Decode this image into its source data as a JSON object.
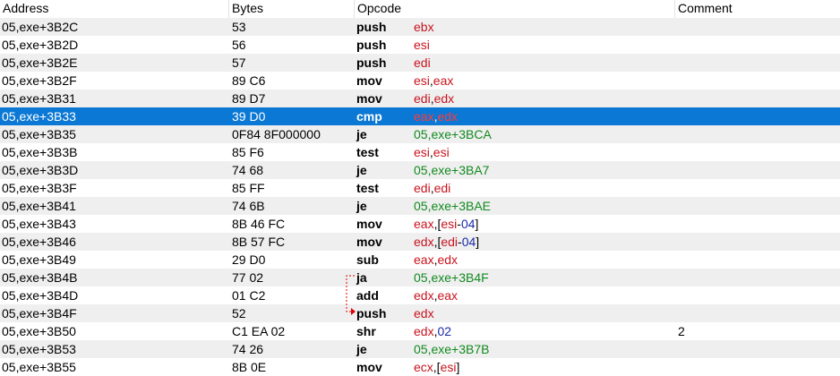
{
  "columns": {
    "address": "Address",
    "bytes": "Bytes",
    "opcode": "Opcode",
    "comment": "Comment"
  },
  "selected_row": 5,
  "colors": {
    "register": "#c8141e",
    "number": "#1a2aa8",
    "symbol": "#138a1e",
    "selection": "#0a78d4",
    "shaded_row": "#efeff0",
    "jump_arrow": "#e00000"
  },
  "rows": [
    {
      "address": "05,exe+3B2C",
      "bytes": "53",
      "opcode": "push",
      "args": [
        {
          "t": "ebx",
          "k": "reg"
        }
      ],
      "comment": ""
    },
    {
      "address": "05,exe+3B2D",
      "bytes": "56",
      "opcode": "push",
      "args": [
        {
          "t": "esi",
          "k": "reg"
        }
      ],
      "comment": ""
    },
    {
      "address": "05,exe+3B2E",
      "bytes": "57",
      "opcode": "push",
      "args": [
        {
          "t": "edi",
          "k": "reg"
        }
      ],
      "comment": ""
    },
    {
      "address": "05,exe+3B2F",
      "bytes": "89 C6",
      "opcode": "mov",
      "args": [
        {
          "t": "esi",
          "k": "reg"
        },
        {
          "t": ",",
          "k": "p"
        },
        {
          "t": "eax",
          "k": "reg"
        }
      ],
      "comment": ""
    },
    {
      "address": "05,exe+3B31",
      "bytes": "89 D7",
      "opcode": "mov",
      "args": [
        {
          "t": "edi",
          "k": "reg"
        },
        {
          "t": ",",
          "k": "p"
        },
        {
          "t": "edx",
          "k": "reg"
        }
      ],
      "comment": ""
    },
    {
      "address": "05,exe+3B33",
      "bytes": "39 D0",
      "opcode": "cmp",
      "args": [
        {
          "t": "eax",
          "k": "reg"
        },
        {
          "t": ",",
          "k": "p"
        },
        {
          "t": "edx",
          "k": "reg"
        }
      ],
      "comment": ""
    },
    {
      "address": "05,exe+3B35",
      "bytes": "0F84 8F000000",
      "opcode": "je",
      "args": [
        {
          "t": "05,exe+3BCA",
          "k": "sym"
        }
      ],
      "comment": ""
    },
    {
      "address": "05,exe+3B3B",
      "bytes": "85 F6",
      "opcode": "test",
      "args": [
        {
          "t": "esi",
          "k": "reg"
        },
        {
          "t": ",",
          "k": "p"
        },
        {
          "t": "esi",
          "k": "reg"
        }
      ],
      "comment": ""
    },
    {
      "address": "05,exe+3B3D",
      "bytes": "74 68",
      "opcode": "je",
      "args": [
        {
          "t": "05,exe+3BA7",
          "k": "sym"
        }
      ],
      "comment": ""
    },
    {
      "address": "05,exe+3B3F",
      "bytes": "85 FF",
      "opcode": "test",
      "args": [
        {
          "t": "edi",
          "k": "reg"
        },
        {
          "t": ",",
          "k": "p"
        },
        {
          "t": "edi",
          "k": "reg"
        }
      ],
      "comment": ""
    },
    {
      "address": "05,exe+3B41",
      "bytes": "74 6B",
      "opcode": "je",
      "args": [
        {
          "t": "05,exe+3BAE",
          "k": "sym"
        }
      ],
      "comment": ""
    },
    {
      "address": "05,exe+3B43",
      "bytes": "8B 46 FC",
      "opcode": "mov",
      "args": [
        {
          "t": "eax",
          "k": "reg"
        },
        {
          "t": ",[",
          "k": "p"
        },
        {
          "t": "esi",
          "k": "reg"
        },
        {
          "t": "-",
          "k": "p"
        },
        {
          "t": "04",
          "k": "num"
        },
        {
          "t": "]",
          "k": "p"
        }
      ],
      "comment": ""
    },
    {
      "address": "05,exe+3B46",
      "bytes": "8B 57 FC",
      "opcode": "mov",
      "args": [
        {
          "t": "edx",
          "k": "reg"
        },
        {
          "t": ",[",
          "k": "p"
        },
        {
          "t": "edi",
          "k": "reg"
        },
        {
          "t": "-",
          "k": "p"
        },
        {
          "t": "04",
          "k": "num"
        },
        {
          "t": "]",
          "k": "p"
        }
      ],
      "comment": ""
    },
    {
      "address": "05,exe+3B49",
      "bytes": "29 D0",
      "opcode": "sub",
      "args": [
        {
          "t": "eax",
          "k": "reg"
        },
        {
          "t": ",",
          "k": "p"
        },
        {
          "t": "edx",
          "k": "reg"
        }
      ],
      "comment": ""
    },
    {
      "address": "05,exe+3B4B",
      "bytes": "77 02",
      "opcode": "ja",
      "args": [
        {
          "t": "05,exe+3B4F",
          "k": "sym"
        }
      ],
      "comment": ""
    },
    {
      "address": "05,exe+3B4D",
      "bytes": "01 C2",
      "opcode": "add",
      "args": [
        {
          "t": "edx",
          "k": "reg"
        },
        {
          "t": ",",
          "k": "p"
        },
        {
          "t": "eax",
          "k": "reg"
        }
      ],
      "comment": ""
    },
    {
      "address": "05,exe+3B4F",
      "bytes": "52",
      "opcode": "push",
      "args": [
        {
          "t": "edx",
          "k": "reg"
        }
      ],
      "comment": ""
    },
    {
      "address": "05,exe+3B50",
      "bytes": "C1 EA 02",
      "opcode": "shr",
      "args": [
        {
          "t": "edx",
          "k": "reg"
        },
        {
          "t": ",",
          "k": "p"
        },
        {
          "t": "02",
          "k": "num"
        }
      ],
      "comment": "2"
    },
    {
      "address": "05,exe+3B53",
      "bytes": "74 26",
      "opcode": "je",
      "args": [
        {
          "t": "05,exe+3B7B",
          "k": "sym"
        }
      ],
      "comment": ""
    },
    {
      "address": "05,exe+3B55",
      "bytes": "8B 0E",
      "opcode": "mov",
      "args": [
        {
          "t": "ecx",
          "k": "reg"
        },
        {
          "t": ",[",
          "k": "p"
        },
        {
          "t": "esi",
          "k": "reg"
        },
        {
          "t": "]",
          "k": "p"
        }
      ],
      "comment": ""
    }
  ]
}
